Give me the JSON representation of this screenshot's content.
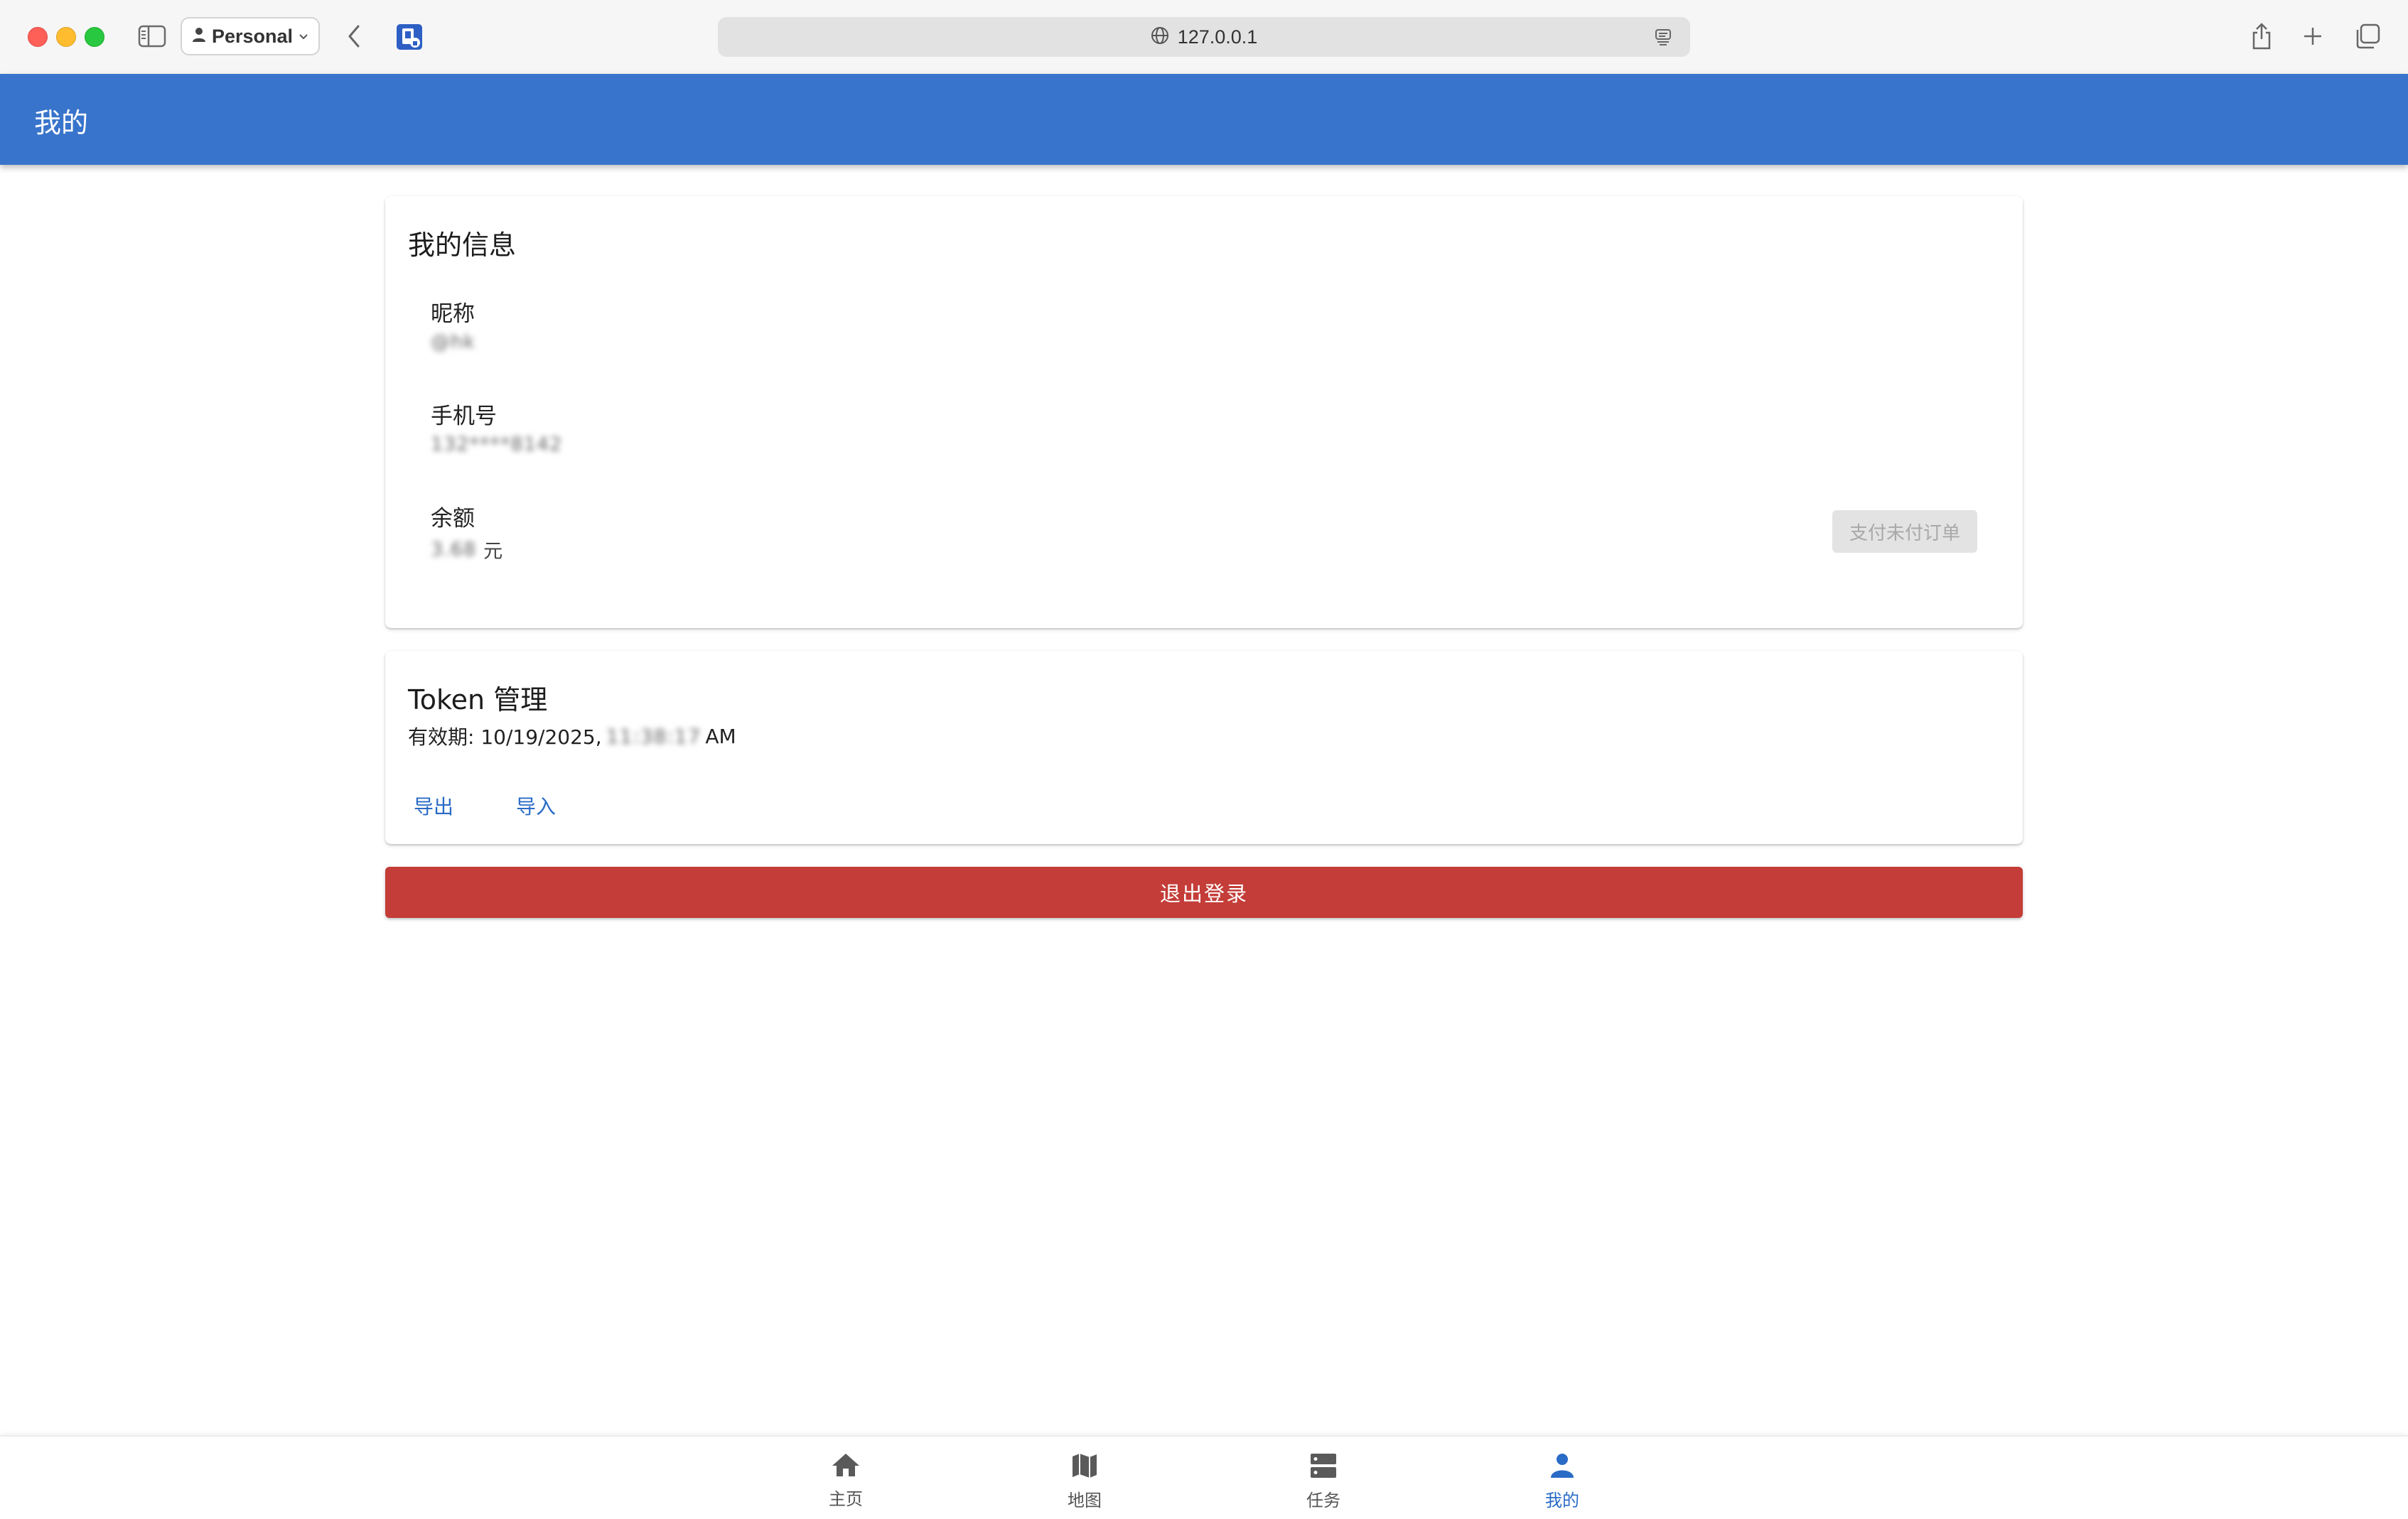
{
  "browser": {
    "profile_label": "Personal",
    "url": "127.0.0.1"
  },
  "appbar": {
    "title": "我的"
  },
  "info_card": {
    "title": "我的信息",
    "nickname_label": "昵称",
    "nickname_value": "@hk",
    "phone_label": "手机号",
    "phone_value": "132****8142",
    "balance_label": "余额",
    "balance_value": "3.68",
    "balance_unit": "元",
    "pay_button": "支付未付订单"
  },
  "token_card": {
    "title": "Token 管理",
    "expiry_prefix": "有效期: 10/19/2025,",
    "expiry_time": "11:38:17",
    "expiry_suffix": "AM",
    "export_button": "导出",
    "import_button": "导入"
  },
  "logout_button": "退出登录",
  "bottom_nav": {
    "home": "主页",
    "map": "地图",
    "tasks": "任务",
    "me": "我的",
    "active": "me"
  },
  "colors": {
    "primary": "#3874cb",
    "danger": "#c43d38",
    "link": "#2a6bc6"
  },
  "icons": {
    "nav_home": "home-icon",
    "nav_map": "map-icon",
    "nav_tasks": "tasks-icon",
    "nav_me": "person-icon"
  }
}
